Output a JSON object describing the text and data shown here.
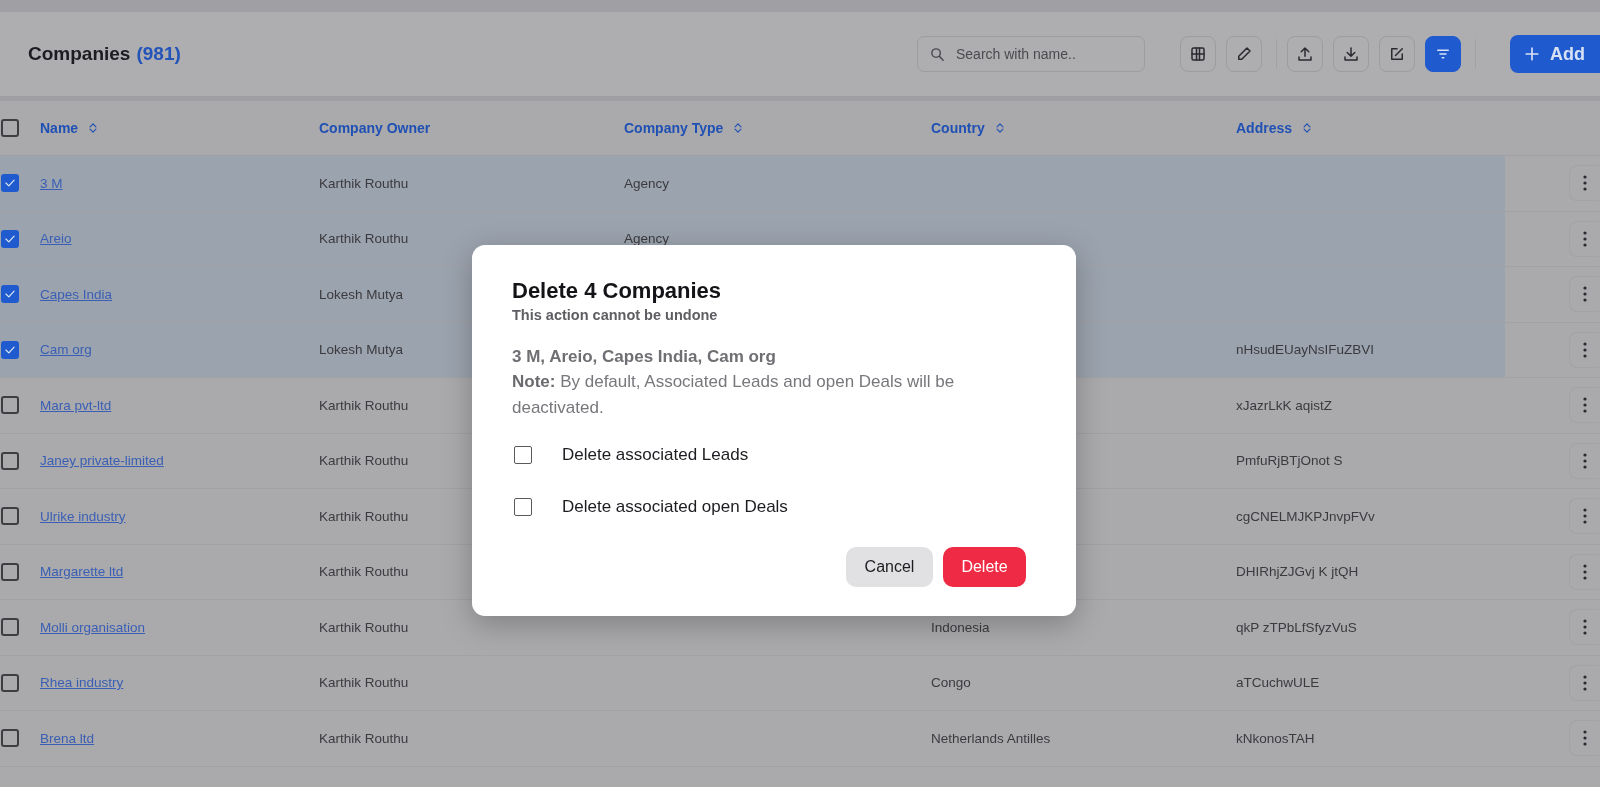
{
  "header": {
    "title": "Companies",
    "count": "(981)",
    "search": {
      "placeholder": "Search with name.."
    },
    "add_button": "Add"
  },
  "table": {
    "select_all_checked": false,
    "columns": [
      {
        "label": "Name",
        "sortable": true
      },
      {
        "label": "Company Owner",
        "sortable": false
      },
      {
        "label": "Company Type",
        "sortable": true
      },
      {
        "label": "Country",
        "sortable": true
      },
      {
        "label": "Address",
        "sortable": true
      }
    ],
    "rows": [
      {
        "selected": true,
        "name": "3 M",
        "owner": "Karthik Routhu",
        "type": "Agency"
      },
      {
        "selected": true,
        "name": "Areio",
        "owner": "Karthik Routhu",
        "type": "Agency"
      },
      {
        "selected": true,
        "name": "Capes India",
        "owner": "Lokesh Mutya"
      },
      {
        "selected": true,
        "name": "Cam org",
        "owner": "Lokesh Mutya",
        "address": "nHsudEUayNsIFuZBVI"
      },
      {
        "selected": false,
        "name": "Mara pvt-ltd",
        "owner": "Karthik Routhu",
        "address": "xJazrLkK aqistZ"
      },
      {
        "selected": false,
        "name": "Janey private-limited",
        "owner": "Karthik Routhu",
        "address": "PmfuRjBTjOnot S"
      },
      {
        "selected": false,
        "name": "Ulrike industry",
        "owner": "Karthik Routhu",
        "address": "cgCNELMJKPJnvpFVv"
      },
      {
        "selected": false,
        "name": "Margarette ltd",
        "owner": "Karthik Routhu",
        "address": "DHIRhjZJGvj K jtQH"
      },
      {
        "selected": false,
        "name": "Molli organisation",
        "owner": "Karthik Routhu",
        "country": "Indonesia",
        "address": "qkP zTPbLfSfyzVuS"
      },
      {
        "selected": false,
        "name": "Rhea industry",
        "owner": "Karthik Routhu",
        "country": "Congo",
        "address": "aTCuchwULE"
      },
      {
        "selected": false,
        "name": "Brena ltd",
        "owner": "Karthik Routhu",
        "country": "Netherlands Antilles",
        "address": "kNkonosTAH"
      }
    ]
  },
  "modal": {
    "title": "Delete 4 Companies",
    "subtitle": "This action cannot be undone",
    "names": "3 M, Areio, Capes India, Cam org",
    "note": "**Note:** By default, Associated Leads and open Deals will be deactivated.",
    "options": [
      {
        "label": "Delete associated Leads",
        "checked": false
      },
      {
        "label": "Delete associated open Deals",
        "checked": false
      }
    ],
    "buttons": [
      {
        "label": "Cancel",
        "kind": "secondary"
      },
      {
        "label": "Delete",
        "kind": "danger"
      }
    ]
  }
}
